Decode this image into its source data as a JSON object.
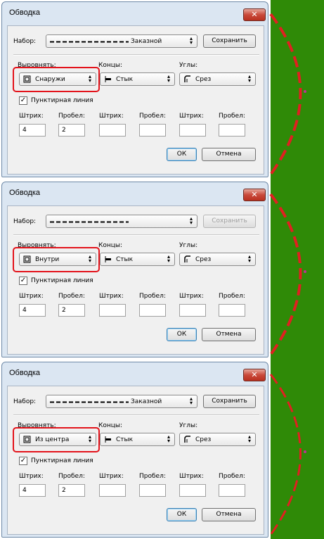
{
  "colors": {
    "accent_red": "#e3131b",
    "background_green": "#2f8a07",
    "stroke_red": "#e02020"
  },
  "panels": [
    {
      "title": "Обводка",
      "close_icon": "✕",
      "preset_label": "Набор:",
      "preset_value": "Заказной",
      "save_button": "Сохранить",
      "save_enabled": true,
      "align_label": "Выровнять:",
      "align_value": "Снаружи",
      "align_icon": "outside-icon",
      "caps_label": "Концы:",
      "caps_value": "Стык",
      "corners_label": "Углы:",
      "corners_value": "Срез",
      "dashed_label": "Пунктирная линия",
      "dashed_checked": true,
      "dash_labels": [
        "Штрих:",
        "Пробел:",
        "Штрих:",
        "Пробел:",
        "Штрих:",
        "Пробел:"
      ],
      "dash_values": [
        "4",
        "2",
        "",
        "",
        "",
        ""
      ],
      "ok_button": "ОК",
      "cancel_button": "Отмена"
    },
    {
      "title": "Обводка",
      "close_icon": "✕",
      "preset_label": "Набор:",
      "preset_value": "",
      "save_button": "Сохранить",
      "save_enabled": false,
      "align_label": "Выровнять:",
      "align_value": "Внутри",
      "align_icon": "inside-icon",
      "caps_label": "Концы:",
      "caps_value": "Стык",
      "corners_label": "Углы:",
      "corners_value": "Срез",
      "dashed_label": "Пунктирная линия",
      "dashed_checked": true,
      "dash_labels": [
        "Штрих:",
        "Пробел:",
        "Штрих:",
        "Пробел:",
        "Штрих:",
        "Пробел:"
      ],
      "dash_values": [
        "4",
        "2",
        "",
        "",
        "",
        ""
      ],
      "ok_button": "ОК",
      "cancel_button": "Отмена"
    },
    {
      "title": "Обводка",
      "close_icon": "✕",
      "preset_label": "Набор:",
      "preset_value": "Заказной",
      "save_button": "Сохранить",
      "save_enabled": true,
      "align_label": "Выровнять:",
      "align_value": "Из центра",
      "align_icon": "center-icon",
      "caps_label": "Концы:",
      "caps_value": "Стык",
      "corners_label": "Углы:",
      "corners_value": "Срез",
      "dashed_label": "Пунктирная линия",
      "dashed_checked": true,
      "dash_labels": [
        "Штрих:",
        "Пробел:",
        "Штрих:",
        "Пробел:",
        "Штрих:",
        "Пробел:"
      ],
      "dash_values": [
        "4",
        "2",
        "",
        "",
        "",
        ""
      ],
      "ok_button": "ОК",
      "cancel_button": "Отмена"
    }
  ]
}
